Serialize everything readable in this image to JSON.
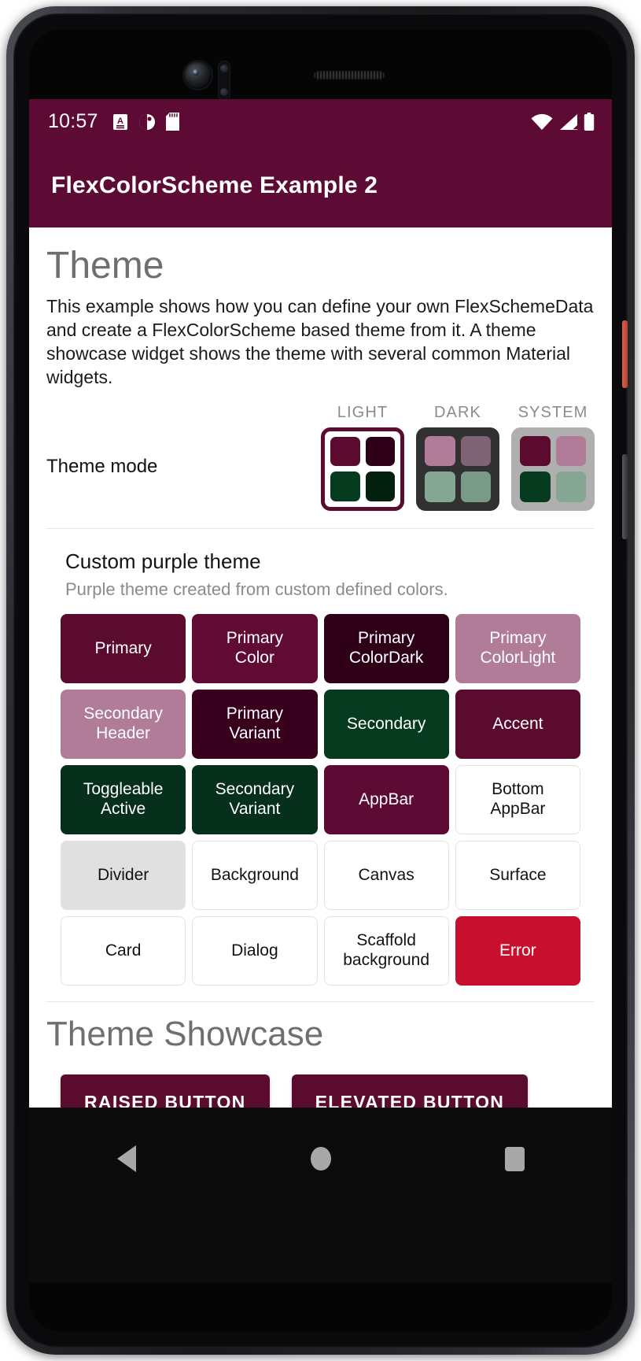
{
  "colors": {
    "appbar": "#5D0B34",
    "primary": "#5A0B2E",
    "primary_variant": "#39001E",
    "primary_color": "#5F0B33",
    "primary_color_dark": "#2E0018",
    "primary_color_light": "#B07C98",
    "secondary": "#063B20",
    "secondary_variant": "#06301B",
    "secondary_header": "#B07C98",
    "accent": "#5A0B2E",
    "error": "#C8102E",
    "divider": "#E0E0E0",
    "white": "#FFFFFF",
    "dark_surface": "#313131",
    "system_grey": "#AFAFAF",
    "dark_primary": "#B07C98",
    "dark_primary_variant": "#7E6475",
    "dark_secondary": "#84A693",
    "dark_secondary_variant": "#799B88"
  },
  "status_bar": {
    "clock": "10:57",
    "left_icons": [
      "screenshot-icon",
      "do-not-disturb-icon",
      "sd-card-icon"
    ],
    "right_icons": [
      "wifi-icon",
      "cellular-signal-icon",
      "battery-icon"
    ]
  },
  "app_bar": {
    "title": "FlexColorScheme Example 2"
  },
  "content": {
    "heading": "Theme",
    "description": "This example shows how you can define your own FlexSchemeData and create a FlexColorScheme based theme from it. A theme showcase widget shows the theme with several common Material widgets.",
    "theme_mode": {
      "label": "Theme mode",
      "selected": "LIGHT",
      "options": [
        {
          "caption": "LIGHT",
          "selected": true,
          "box_background": "#FFFFFF",
          "swatches": [
            "#5A0B2E",
            "#2E0018",
            "#063B20",
            "#04200F"
          ]
        },
        {
          "caption": "DARK",
          "selected": false,
          "box_background": "#313131",
          "swatches": [
            "#B07C98",
            "#7E6475",
            "#84A693",
            "#799B88"
          ]
        },
        {
          "caption": "SYSTEM",
          "selected": false,
          "box_background": "#AFAFAF",
          "swatches": [
            "#5A0B2E",
            "#B07C98",
            "#063B20",
            "#84A693"
          ]
        }
      ]
    },
    "scheme": {
      "title": "Custom purple theme",
      "subtitle": "Purple theme created from custom defined colors."
    },
    "color_boxes": [
      {
        "label": "Primary",
        "bg": "#5A0B2E",
        "fg": "#FFFFFF",
        "outlined": false
      },
      {
        "label": "Primary\nColor",
        "bg": "#5F0B33",
        "fg": "#FFFFFF",
        "outlined": false
      },
      {
        "label": "Primary\nColorDark",
        "bg": "#2E0018",
        "fg": "#FFFFFF",
        "outlined": false
      },
      {
        "label": "Primary\nColorLight",
        "bg": "#B07C98",
        "fg": "#FFFFFF",
        "outlined": false
      },
      {
        "label": "Secondary\nHeader",
        "bg": "#B07C98",
        "fg": "#FFFFFF",
        "outlined": false
      },
      {
        "label": "Primary\nVariant",
        "bg": "#39001E",
        "fg": "#FFFFFF",
        "outlined": false
      },
      {
        "label": "Secondary",
        "bg": "#063B20",
        "fg": "#FFFFFF",
        "outlined": false
      },
      {
        "label": "Accent",
        "bg": "#5A0B2E",
        "fg": "#FFFFFF",
        "outlined": false
      },
      {
        "label": "Toggleable\nActive",
        "bg": "#06301B",
        "fg": "#FFFFFF",
        "outlined": false
      },
      {
        "label": "Secondary\nVariant",
        "bg": "#06301B",
        "fg": "#FFFFFF",
        "outlined": false
      },
      {
        "label": "AppBar",
        "bg": "#5D0B34",
        "fg": "#FFFFFF",
        "outlined": false
      },
      {
        "label": "Bottom\nAppBar",
        "bg": "#FFFFFF",
        "fg": "#121212",
        "outlined": true
      },
      {
        "label": "Divider",
        "bg": "#E0E0E0",
        "fg": "#121212",
        "outlined": true
      },
      {
        "label": "Background",
        "bg": "#FFFFFF",
        "fg": "#121212",
        "outlined": true
      },
      {
        "label": "Canvas",
        "bg": "#FFFFFF",
        "fg": "#121212",
        "outlined": true
      },
      {
        "label": "Surface",
        "bg": "#FFFFFF",
        "fg": "#121212",
        "outlined": true
      },
      {
        "label": "Card",
        "bg": "#FFFFFF",
        "fg": "#121212",
        "outlined": true
      },
      {
        "label": "Dialog",
        "bg": "#FFFFFF",
        "fg": "#121212",
        "outlined": true
      },
      {
        "label": "Scaffold\nbackground",
        "bg": "#FFFFFF",
        "fg": "#121212",
        "outlined": true
      },
      {
        "label": "Error",
        "bg": "#C8102E",
        "fg": "#FFFFFF",
        "outlined": false
      }
    ],
    "showcase": {
      "heading": "Theme Showcase",
      "buttons": [
        {
          "label": "RAISED BUTTON"
        },
        {
          "label": "ELEVATED BUTTON"
        }
      ]
    }
  },
  "nav_bar": {
    "buttons": [
      "back-icon",
      "home-icon",
      "recents-icon"
    ]
  }
}
